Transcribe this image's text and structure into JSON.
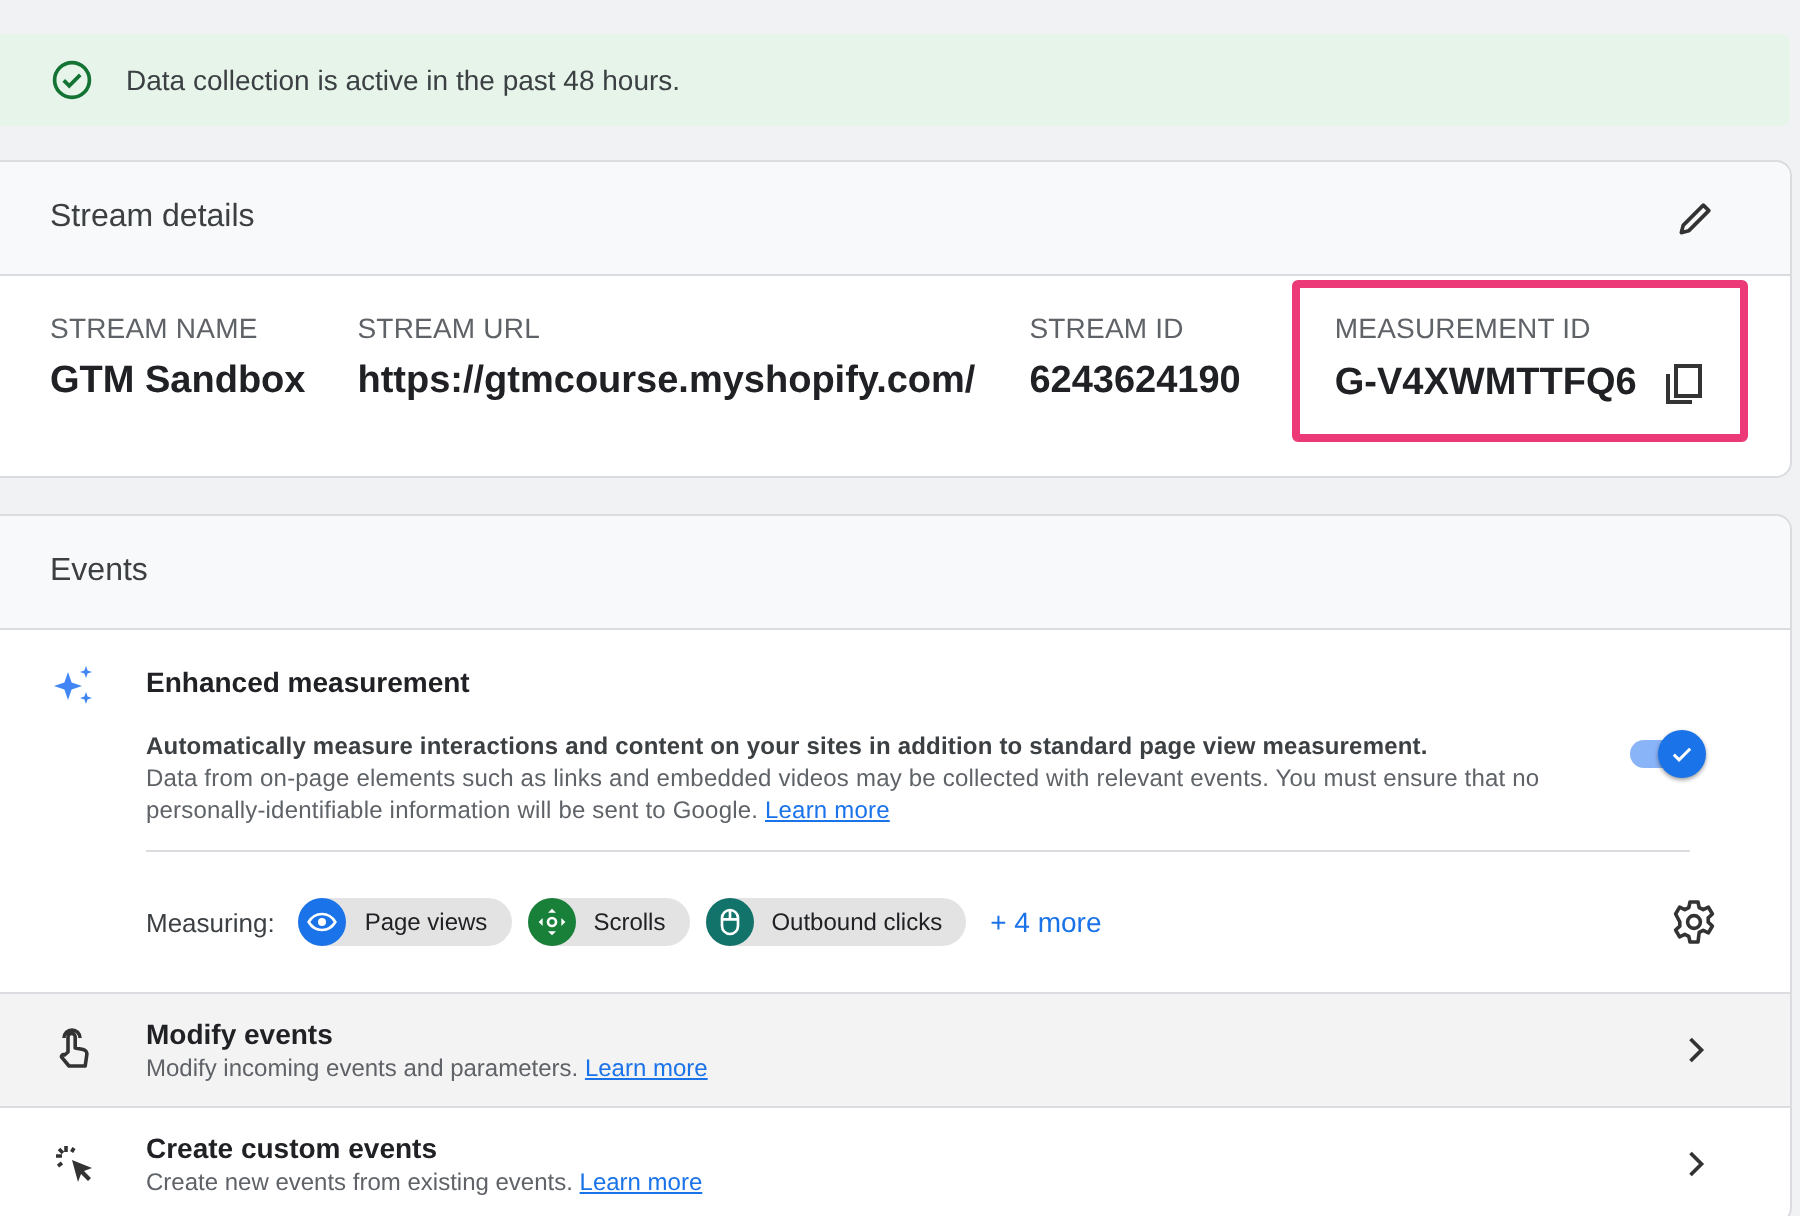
{
  "banner": {
    "text": "Data collection is active in the past 48 hours."
  },
  "stream_details": {
    "title": "Stream details",
    "fields": [
      {
        "label": "STREAM NAME",
        "value": "GTM Sandbox",
        "highlighted": false,
        "copyable": false
      },
      {
        "label": "STREAM URL",
        "value": "https://gtmcourse.myshopify.com/",
        "highlighted": false,
        "copyable": false
      },
      {
        "label": "STREAM ID",
        "value": "6243624190",
        "highlighted": false,
        "copyable": false
      },
      {
        "label": "MEASUREMENT ID",
        "value": "G-V4XWMTTFQ6",
        "highlighted": true,
        "copyable": true
      }
    ]
  },
  "events": {
    "title": "Events",
    "enhanced": {
      "title": "Enhanced measurement",
      "on": true,
      "summary": "Automatically measure interactions and content on your sites in addition to standard page view measurement.",
      "note": "Data from on-page elements such as links and embedded videos may be collected with relevant events. You must ensure that no personally-identifiable information will be sent to Google.",
      "link": "Learn more",
      "measuring_label": "Measuring:",
      "chips": [
        {
          "kind": "eye",
          "label": "Page views",
          "color": "#1a73e8"
        },
        {
          "kind": "scroll",
          "label": "Scrolls",
          "color": "#188038"
        },
        {
          "kind": "mouse",
          "label": "Outbound clicks",
          "color": "#12736b"
        }
      ],
      "more": "+ 4 more"
    },
    "rows": [
      {
        "kind": "touch",
        "title": "Modify events",
        "description": "Modify incoming events and parameters.",
        "link": "Learn more",
        "highlighted": true
      },
      {
        "kind": "cursor",
        "title": "Create custom events",
        "description": "Create new events from existing events.",
        "link": "Learn more",
        "highlighted": false
      }
    ]
  }
}
